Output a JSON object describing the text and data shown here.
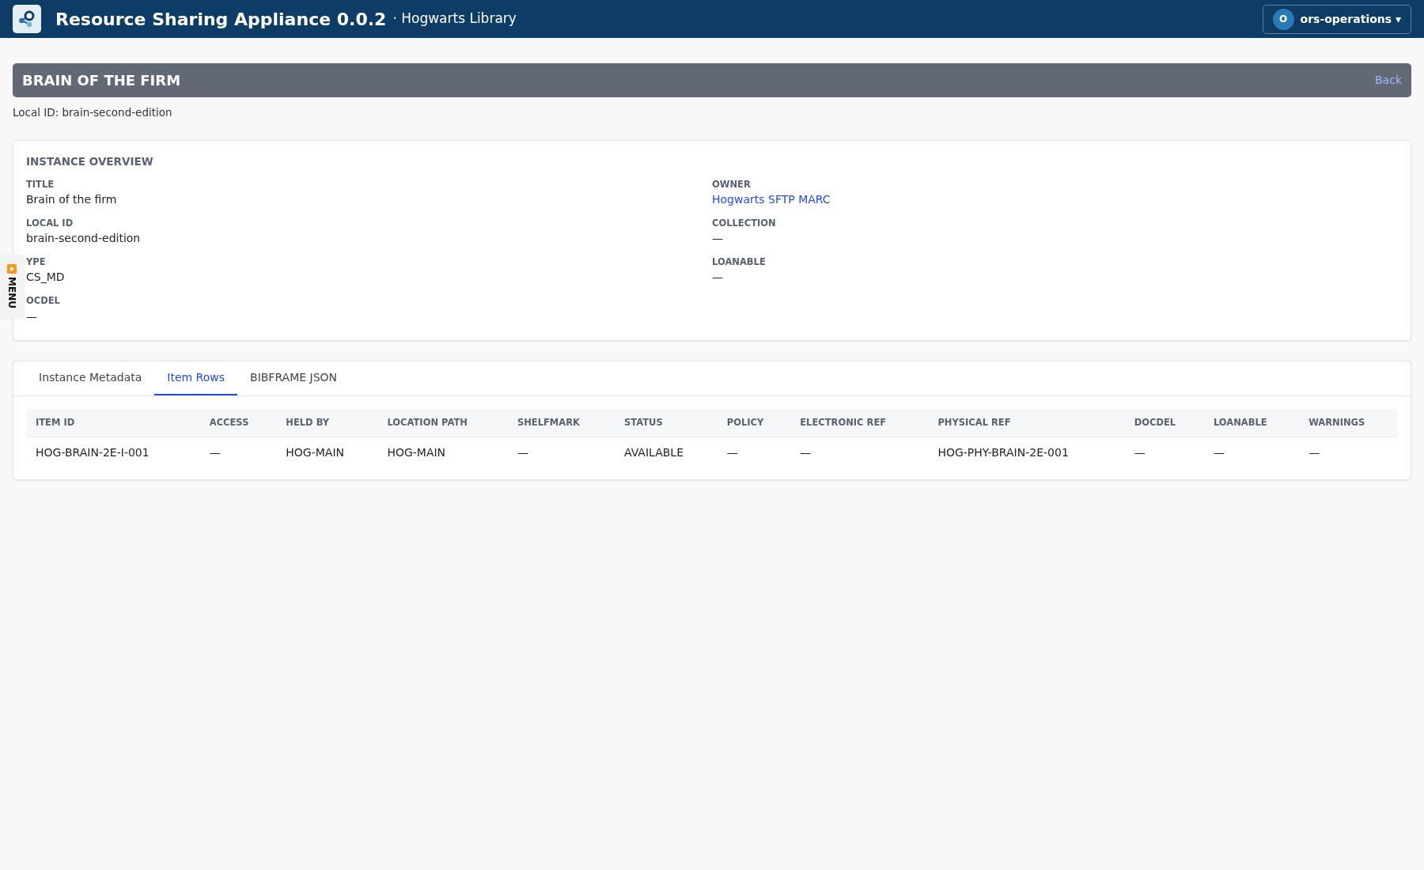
{
  "header": {
    "app_title": "Resource Sharing Appliance 0.0.2",
    "subtitle": "· Hogwarts Library",
    "user": {
      "initial": "O",
      "name": "ors-operations",
      "caret": "▾"
    }
  },
  "page_title": {
    "title": "BRAIN OF THE FIRM",
    "back_link": "Back"
  },
  "local_id_line": "Local ID: brain-second-edition",
  "side_menu": {
    "label": "MENU"
  },
  "overview": {
    "heading": "INSTANCE OVERVIEW",
    "left_fields": [
      {
        "label": "TITLE",
        "value": "Brain of the firm",
        "kind": "text"
      },
      {
        "label": "LOCAL ID",
        "value": "brain-second-edition",
        "kind": "text"
      },
      {
        "label": "YPE",
        "value": "CS_MD",
        "kind": "text"
      },
      {
        "label": "OCDEL",
        "value": "—",
        "kind": "text"
      }
    ],
    "right_fields": [
      {
        "label": "OWNER",
        "value": "Hogwarts SFTP MARC",
        "kind": "link"
      },
      {
        "label": "COLLECTION",
        "value": "—",
        "kind": "text"
      },
      {
        "label": "LOANABLE",
        "value": "—",
        "kind": "text"
      }
    ]
  },
  "tabs": [
    {
      "label": "Instance Metadata",
      "selected": false
    },
    {
      "label": "Item Rows",
      "selected": true
    },
    {
      "label": "BIBFRAME JSON",
      "selected": false
    }
  ],
  "table": {
    "columns": [
      "ITEM ID",
      "ACCESS",
      "HELD BY",
      "LOCATION PATH",
      "SHELFMARK",
      "STATUS",
      "POLICY",
      "ELECTRONIC REF",
      "PHYSICAL REF",
      "DOCDEL",
      "LOANABLE",
      "WARNINGS"
    ],
    "rows": [
      [
        "HOG-BRAIN-2E-I-001",
        "—",
        "HOG-MAIN",
        "HOG-MAIN",
        "—",
        "AVAILABLE",
        "—",
        "—",
        "HOG-PHY-BRAIN-2E-001",
        "—",
        "—",
        "—"
      ]
    ]
  }
}
